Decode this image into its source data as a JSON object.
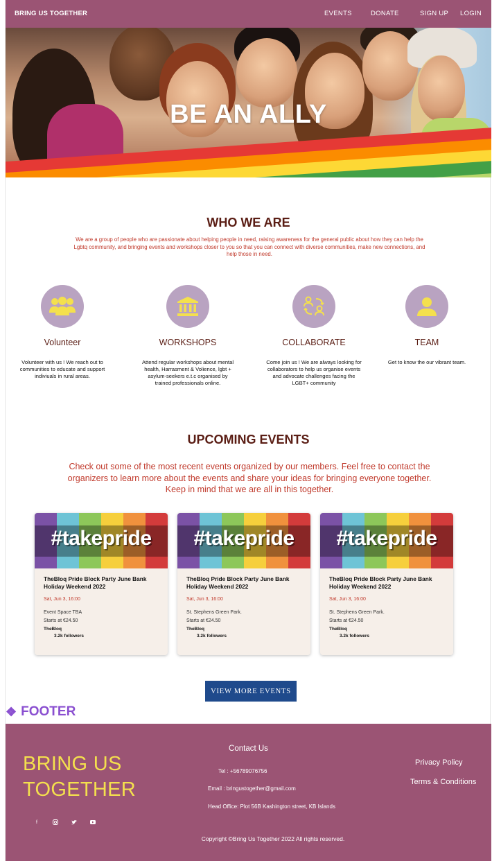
{
  "nav": {
    "brand": "BRING US TOGETHER",
    "links": [
      "EVENTS",
      "DONATE",
      "SIGN UP",
      "LOGIN"
    ]
  },
  "hero": {
    "title": "BE AN ALLY"
  },
  "who": {
    "heading": "WHO WE ARE",
    "text": "We are a group of people who are passionate about helping people in need, raising awareness for the general public about how they can help the Lgbtq community, and bringing events and workshops closer to you so that you can connect with diverse communities, make new connections, and help those in need."
  },
  "features": [
    {
      "icon": "group-icon",
      "title": "Volunteer",
      "desc": "Volunteer with us ! We reach out to communities to educate and support indiviuals in rural areas."
    },
    {
      "icon": "building-icon",
      "title": "WORKSHOPS",
      "desc": "Attend regular workshops about mental health, Harrasment & Volience, lgbt + asylum-seekers e.t.c  organised by trained professionals online."
    },
    {
      "icon": "collaborate-icon",
      "title": "COLLABORATE",
      "desc": "Come join us ! We are always looking for collaborators to help us  organise events and advocate challenges facing the LGBT+ community"
    },
    {
      "icon": "person-icon",
      "title": "TEAM",
      "desc": "Get to know the  our vibrant team."
    }
  ],
  "events": {
    "heading": "UPCOMING EVENTS",
    "text": "Check out some of the most recent events organized by our members. Feel free to contact the organizers to learn more about the events and share your ideas for bringing everyone together. Keep in mind that we are all in this together.",
    "cards": [
      {
        "image_text": "#takepride",
        "title": "TheBloq Pride Block Party June Bank Holiday Weekend 2022",
        "date": "Sat, Jun 3, 16:00",
        "location": "Event Space TBA",
        "price": "Starts at €24.50",
        "organizer": "TheBloq",
        "followers": "3.2k followers"
      },
      {
        "image_text": "#takepride",
        "title": "TheBloq Pride Block Party June Bank Holiday Weekend 2022",
        "date": "Sat, Jun 3, 16:00",
        "location": "St. Stephens Green Park.",
        "price": "Starts at €24.50",
        "organizer": "TheBloq",
        "followers": "3.2k followers"
      },
      {
        "image_text": "#takepride",
        "title": "TheBloq Pride Block Party June Bank Holiday Weekend 2022",
        "date": "Sat, Jun 3, 16:00",
        "location": "St. Stephens Green Park.",
        "price": "Starts at €24.50",
        "organizer": "TheBloq",
        "followers": "3.2k followers"
      }
    ],
    "view_more": "VIEW MORE EVENTS"
  },
  "footer_label": "FOOTER",
  "footer": {
    "brand_line1": "BRING US",
    "brand_line2": "TOGETHER",
    "social": [
      "facebook-icon",
      "instagram-icon",
      "twitter-icon",
      "youtube-icon"
    ],
    "contact_heading": "Contact Us",
    "tel": "Tel : +56789076756",
    "email": "Email : bringustogether@gmail.com",
    "office": "Head Office:  Plot 56B Kashington street, KB Islands",
    "links": [
      "Privacy Policy",
      "Terms & Conditions"
    ],
    "copyright": "Copyright ©Bring Us Together 2022 All rights reserved."
  },
  "colors": {
    "brand": "#9b5474",
    "heading": "#5a1d14",
    "accent_text": "#c0392b",
    "icon_circle": "#b9a3c1",
    "icon_glyph": "#f4e04d",
    "button": "#1f4a8c",
    "footer_label": "#8a4fd0"
  }
}
